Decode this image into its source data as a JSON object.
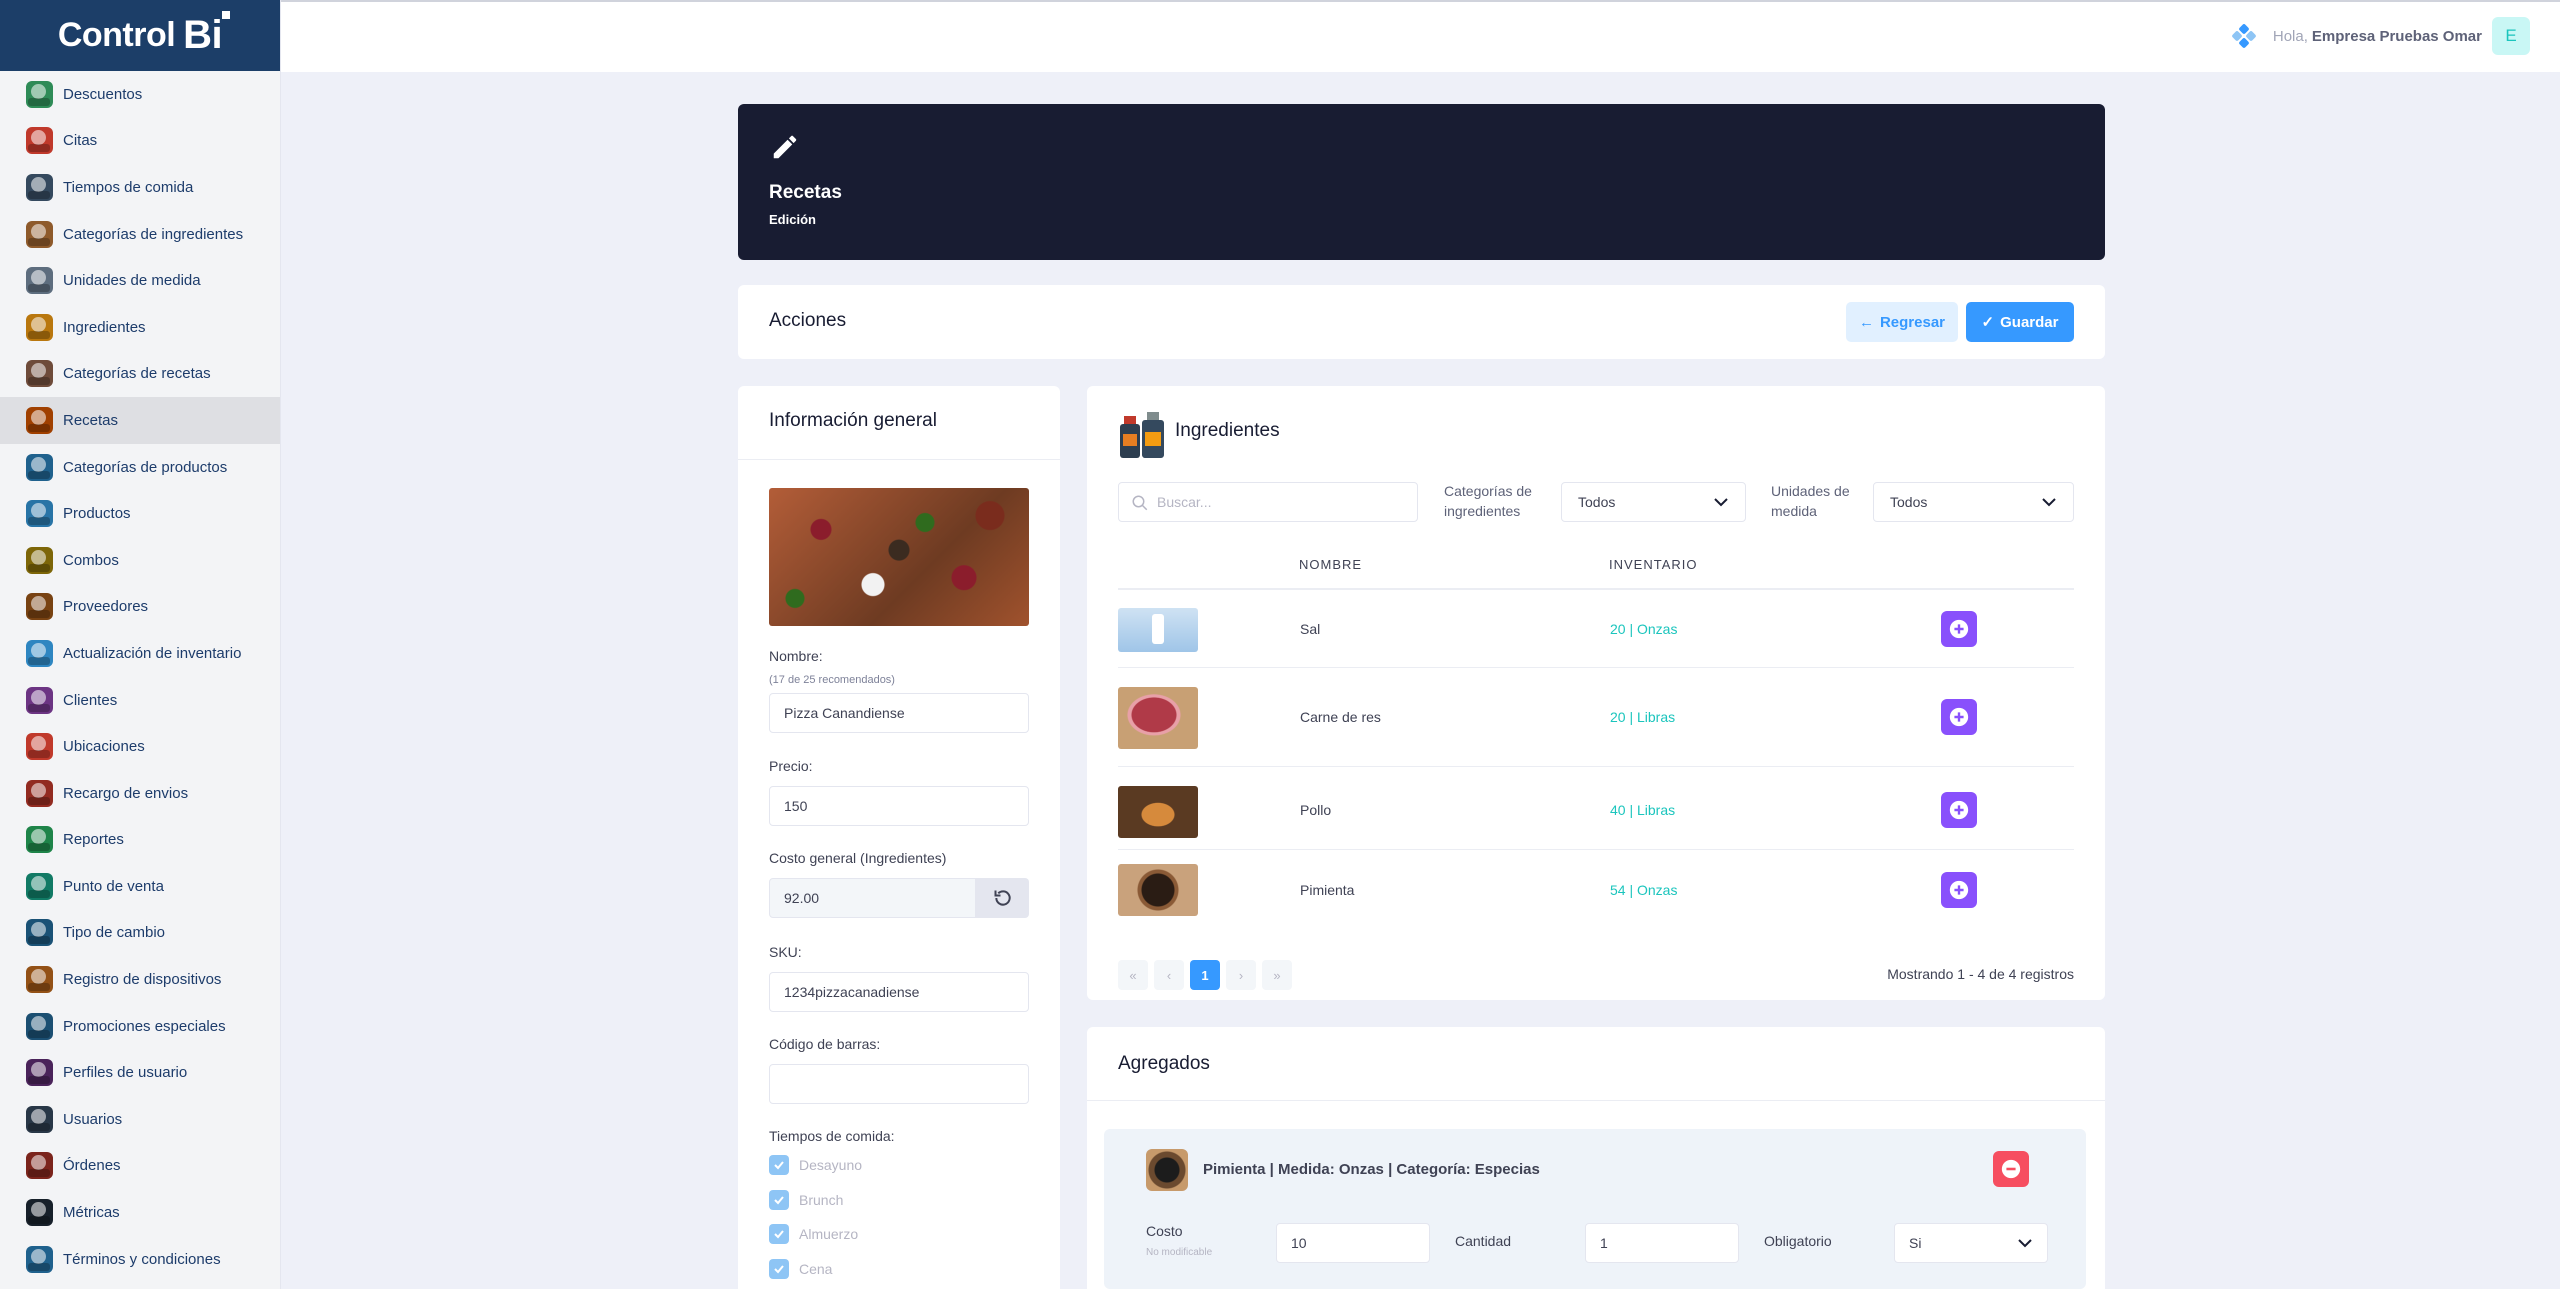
{
  "brand": {
    "name": "Control",
    "mark": "Bi"
  },
  "sidebar": {
    "items": [
      {
        "label": "Descuentos",
        "color": "#2e8b57"
      },
      {
        "label": "Citas",
        "color": "#c0392b"
      },
      {
        "label": "Tiempos de comida",
        "color": "#34495e"
      },
      {
        "label": "Categorías de ingredientes",
        "color": "#8e5a2b"
      },
      {
        "label": "Unidades de medida",
        "color": "#5d6d7e"
      },
      {
        "label": "Ingredientes",
        "color": "#b9770e"
      },
      {
        "label": "Categorías de recetas",
        "color": "#6e4b3a"
      },
      {
        "label": "Recetas",
        "color": "#a04000"
      },
      {
        "label": "Categorías de productos",
        "color": "#1f618d"
      },
      {
        "label": "Productos",
        "color": "#2874a6"
      },
      {
        "label": "Combos",
        "color": "#7d6608"
      },
      {
        "label": "Proveedores",
        "color": "#784212"
      },
      {
        "label": "Actualización de inventario",
        "color": "#2e86c1"
      },
      {
        "label": "Clientes",
        "color": "#6c3483"
      },
      {
        "label": "Ubicaciones",
        "color": "#c0392b"
      },
      {
        "label": "Recargo de envios",
        "color": "#922b21"
      },
      {
        "label": "Reportes",
        "color": "#1e8449"
      },
      {
        "label": "Punto de venta",
        "color": "#117a65"
      },
      {
        "label": "Tipo de cambio",
        "color": "#1a5276"
      },
      {
        "label": "Registro de dispositivos",
        "color": "#935116"
      },
      {
        "label": "Promociones especiales",
        "color": "#1b4f72"
      },
      {
        "label": "Perfiles de usuario",
        "color": "#4a235a"
      },
      {
        "label": "Usuarios",
        "color": "#283747"
      },
      {
        "label": "Órdenes",
        "color": "#7b241c"
      },
      {
        "label": "Métricas",
        "color": "#17202a"
      },
      {
        "label": "Términos y condiciones",
        "color": "#1f618d"
      }
    ],
    "active_index": 7
  },
  "topbar": {
    "greeting": "Hola,",
    "user": "Empresa Pruebas Omar",
    "avatar_letter": "E"
  },
  "banner": {
    "title": "Recetas",
    "subtitle": "Edición",
    "icon": "pencil-icon"
  },
  "actions": {
    "title": "Acciones",
    "back_label": "Regresar",
    "save_label": "Guardar"
  },
  "info": {
    "title": "Información general",
    "name_label": "Nombre:",
    "name_hint": "(17 de 25 recomendados)",
    "name_value": "Pizza Canandiense",
    "price_label": "Precio:",
    "price_value": "150",
    "cost_label": "Costo general (Ingredientes)",
    "cost_value": "92.00",
    "sku_label": "SKU:",
    "sku_value": "1234pizzacanadiense",
    "barcode_label": "Código de barras:",
    "barcode_value": "",
    "meal_times_label": "Tiempos de comida:",
    "meal_times": [
      "Desayuno",
      "Brunch",
      "Almuerzo",
      "Cena"
    ]
  },
  "ingredients": {
    "title": "Ingredientes",
    "search_placeholder": "Buscar...",
    "category_label": "Categorías de ingredientes",
    "category_value": "Todos",
    "unit_label": "Unidades de medida",
    "unit_value": "Todos",
    "col_name": "NOMBRE",
    "col_inventory": "INVENTARIO",
    "rows": [
      {
        "name": "Sal",
        "inventory": "20 | Onzas"
      },
      {
        "name": "Carne de res",
        "inventory": "20 | Libras"
      },
      {
        "name": "Pollo",
        "inventory": "40 | Libras"
      },
      {
        "name": "Pimienta",
        "inventory": "54 | Onzas"
      }
    ],
    "pager": {
      "first": "«",
      "prev": "‹",
      "current": "1",
      "next": "›",
      "last": "»"
    },
    "showing": "Mostrando 1 - 4 de 4 registros"
  },
  "added": {
    "title": "Agregados",
    "item_title": "Pimienta | Medida: Onzas | Categoría: Especias",
    "cost_label": "Costo",
    "cost_hint": "No modificable",
    "cost_value": "10",
    "qty_label": "Cantidad",
    "qty_value": "1",
    "required_label": "Obligatorio",
    "required_value": "Si"
  },
  "colors": {
    "brand": "#1c3e68",
    "primary": "#3699ff",
    "accent": "#8950fc",
    "success": "#1bc5bd",
    "danger": "#f64e60",
    "banner": "#181c32"
  }
}
